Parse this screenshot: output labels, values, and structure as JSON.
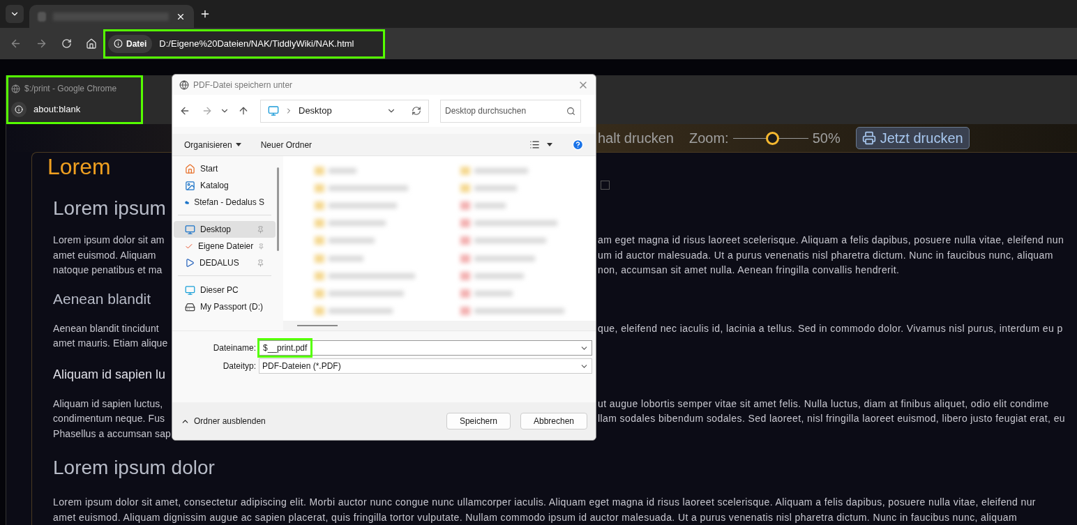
{
  "browser": {
    "address_bar": {
      "chip": "Datei",
      "url": "D:/Eigene%20Dateien/NAK/TiddlyWiki/NAK.html",
      "highlighted": true
    }
  },
  "popup_window": {
    "title": "$:/print - Google Chrome",
    "address": "about:blank",
    "highlighted": true
  },
  "page": {
    "toolbar": {
      "label": "halt drucken",
      "zoom_label": "Zoom:",
      "zoom": {
        "level": 0.52
      },
      "zoom_reading": "50%",
      "print_button": "Jetzt drucken"
    },
    "card_title": "Lorem",
    "checkbox": {
      "checked": false
    },
    "blocks": [
      {
        "kind": "h2",
        "left": "Lorem ipsum"
      },
      {
        "kind": "paragraph",
        "lines": [
          {
            "left": "Lorem ipsum dolor sit am",
            "right": "am eget magna id risus laoreet scelerisque. Aliquam a felis dapibus, posuere nulla vitae, eleifend nun"
          },
          {
            "left": "amet euismod. Aliquam",
            "right": "um id auctor malesuada. Ut a purus venenatis nisl pharetra dictum. Nunc in faucibus nunc, aliquam"
          },
          {
            "left": "natoque penatibus et ma",
            "right": "non, accumsan sit amet nulla. Aenean fringilla convallis hendrerit."
          }
        ]
      },
      {
        "kind": "h3",
        "left": "Aenean blandit"
      },
      {
        "kind": "paragraph",
        "lines": [
          {
            "left": "Aenean blandit tincidunt",
            "right": "que, eleifend nec iaculis id, lacinia a tellus. Sed in commodo dolor. Vivamus nisl purus, interdum eu p"
          },
          {
            "left": "amet mauris. Etiam alique"
          }
        ]
      },
      {
        "kind": "h4",
        "left": "Aliquam id sapien lu"
      },
      {
        "kind": "paragraph",
        "lines": [
          {
            "left": "Aliquam id sapien luctus,",
            "right": "ut augue lobortis semper vitae sit amet felis. Nulla luctus, diam at finibus aliquet, odio elit condime"
          },
          {
            "left": "condimentum neque. Fus",
            "right": "llam sodales bibendum sodales. Sed laoreet, nisl fringilla laoreet euismod, libero justo feugiat erat, eu"
          },
          {
            "left": "Phasellus a accumsan sap"
          }
        ]
      },
      {
        "kind": "h2",
        "left": "Lorem ipsum dolor"
      },
      {
        "kind": "paragraph",
        "lines": [
          {
            "left": "Lorem ipsum dolor sit amet, consectetur adipiscing elit. Morbi auctor nunc congue nunc ullamcorper iaculis. Aliquam eget magna id risus laoreet scelerisque. Aliquam a felis dapibus, posuere nulla vitae, eleifend nur"
          },
          {
            "left": "amet euismod. Aliquam dignissim augue ac sapien placerat, quis fringilla tortor vulputate. Nullam commodo ipsum id auctor malesuada. Ut a purus venenatis nisl pharetra dictum. Nunc in faucibus nunc, aliquam"
          }
        ]
      }
    ]
  },
  "dialog": {
    "title": "PDF-Datei speichern unter",
    "location": "Desktop",
    "search": {
      "placeholder": "Desktop durchsuchen"
    },
    "commands": [
      {
        "label": "Organisieren",
        "dropdown": true
      },
      {
        "label": "Neuer Ordner",
        "dropdown": false
      }
    ],
    "sidebar": [
      [
        {
          "kind": "home",
          "label": "Start",
          "selected": false,
          "pinned": false
        },
        {
          "kind": "gallery",
          "label": "Katalog",
          "selected": false,
          "pinned": false
        },
        {
          "kind": "cloud",
          "label": "Stefan - Dedalus S",
          "selected": false,
          "pinned": false
        }
      ],
      [
        {
          "kind": "desktop",
          "label": "Desktop",
          "selected": true,
          "pinned": true
        },
        {
          "kind": "check",
          "label": "Eigene Dateier",
          "selected": false,
          "pinned": true
        },
        {
          "kind": "play",
          "label": "DEDALUS",
          "selected": false,
          "pinned": true
        }
      ],
      [
        {
          "kind": "pc",
          "label": "Dieser PC",
          "selected": false,
          "pinned": false
        },
        {
          "kind": "drive",
          "label": "My Passport (D:)",
          "selected": false,
          "pinned": false
        }
      ]
    ],
    "filename_label": "Dateiname:",
    "filename": {
      "value": "$__print.pdf",
      "highlighted": true
    },
    "filetype_label": "Dateityp:",
    "filetype": "PDF-Dateien (*.PDF)",
    "toggle": "Ordner ausblenden",
    "buttons": [
      "Speichern",
      "Abbrechen"
    ]
  }
}
